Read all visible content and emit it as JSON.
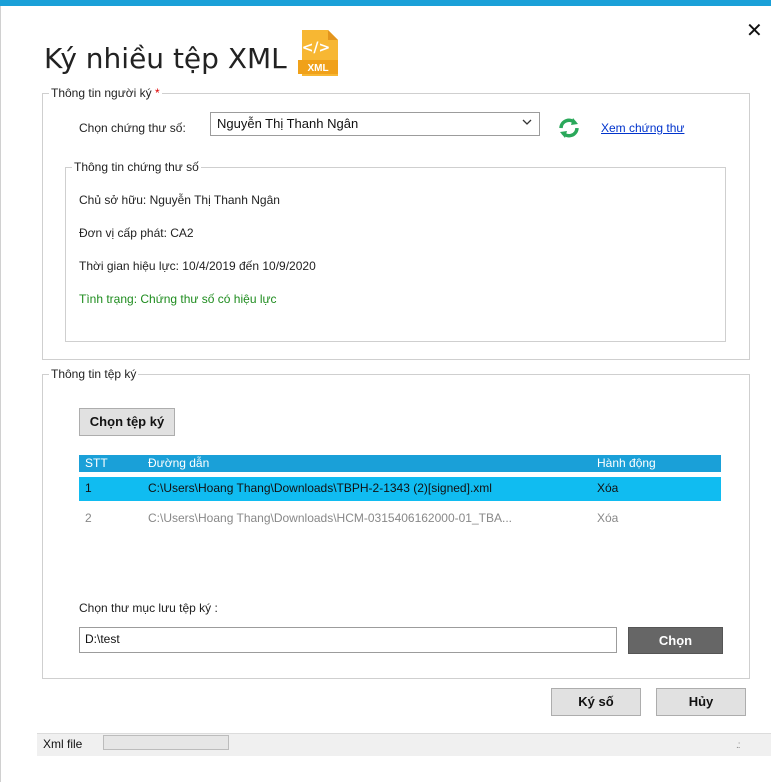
{
  "dialog": {
    "title": "Ký nhiều tệp XML",
    "icon_label": "XML",
    "close_glyph": "✕"
  },
  "signer": {
    "legend": "Thông tin người ký",
    "required_mark": "*",
    "cert_label": "Chọn chứng thư số:",
    "cert_selected": "Nguyễn Thị Thanh Ngân",
    "view_cert_link": "Xem chứng thư",
    "cert_info": {
      "legend": "Thông tin chứng thư số",
      "owner": "Chủ sở hữu: Nguyễn Thị Thanh Ngân",
      "issuer": "Đơn vị cấp phát: CA2",
      "validity": "Thời gian hiệu lực: 10/4/2019 đến 10/9/2020",
      "status": "Tình trạng: Chứng thư số có hiệu lực"
    }
  },
  "files": {
    "legend": "Thông tin tệp ký",
    "choose_button": "Chọn tệp ký",
    "columns": [
      "STT",
      "Đường dẫn",
      "Hành động"
    ],
    "rows": [
      {
        "stt": "1",
        "path": "C:\\Users\\Hoang Thang\\Downloads\\TBPH-2-1343 (2)[signed].xml",
        "action": "Xóa"
      },
      {
        "stt": "2",
        "path": "C:\\Users\\Hoang Thang\\Downloads\\HCM-0315406162000-01_TBA...",
        "action": "Xóa"
      }
    ],
    "folder_label": "Chọn thư mục lưu tệp ký :",
    "folder_value": "D:\\test",
    "folder_button": "Chọn"
  },
  "footer": {
    "sign_button": "Ký số",
    "cancel_button": "Hủy"
  },
  "statusbar": {
    "label": "Xml file",
    "grip": ".:"
  },
  "colors": {
    "accent": "#1aa0d8",
    "selected_row": "#10bcf1",
    "status_valid": "#1e8c1e",
    "icon_orange": "#f5a623"
  }
}
